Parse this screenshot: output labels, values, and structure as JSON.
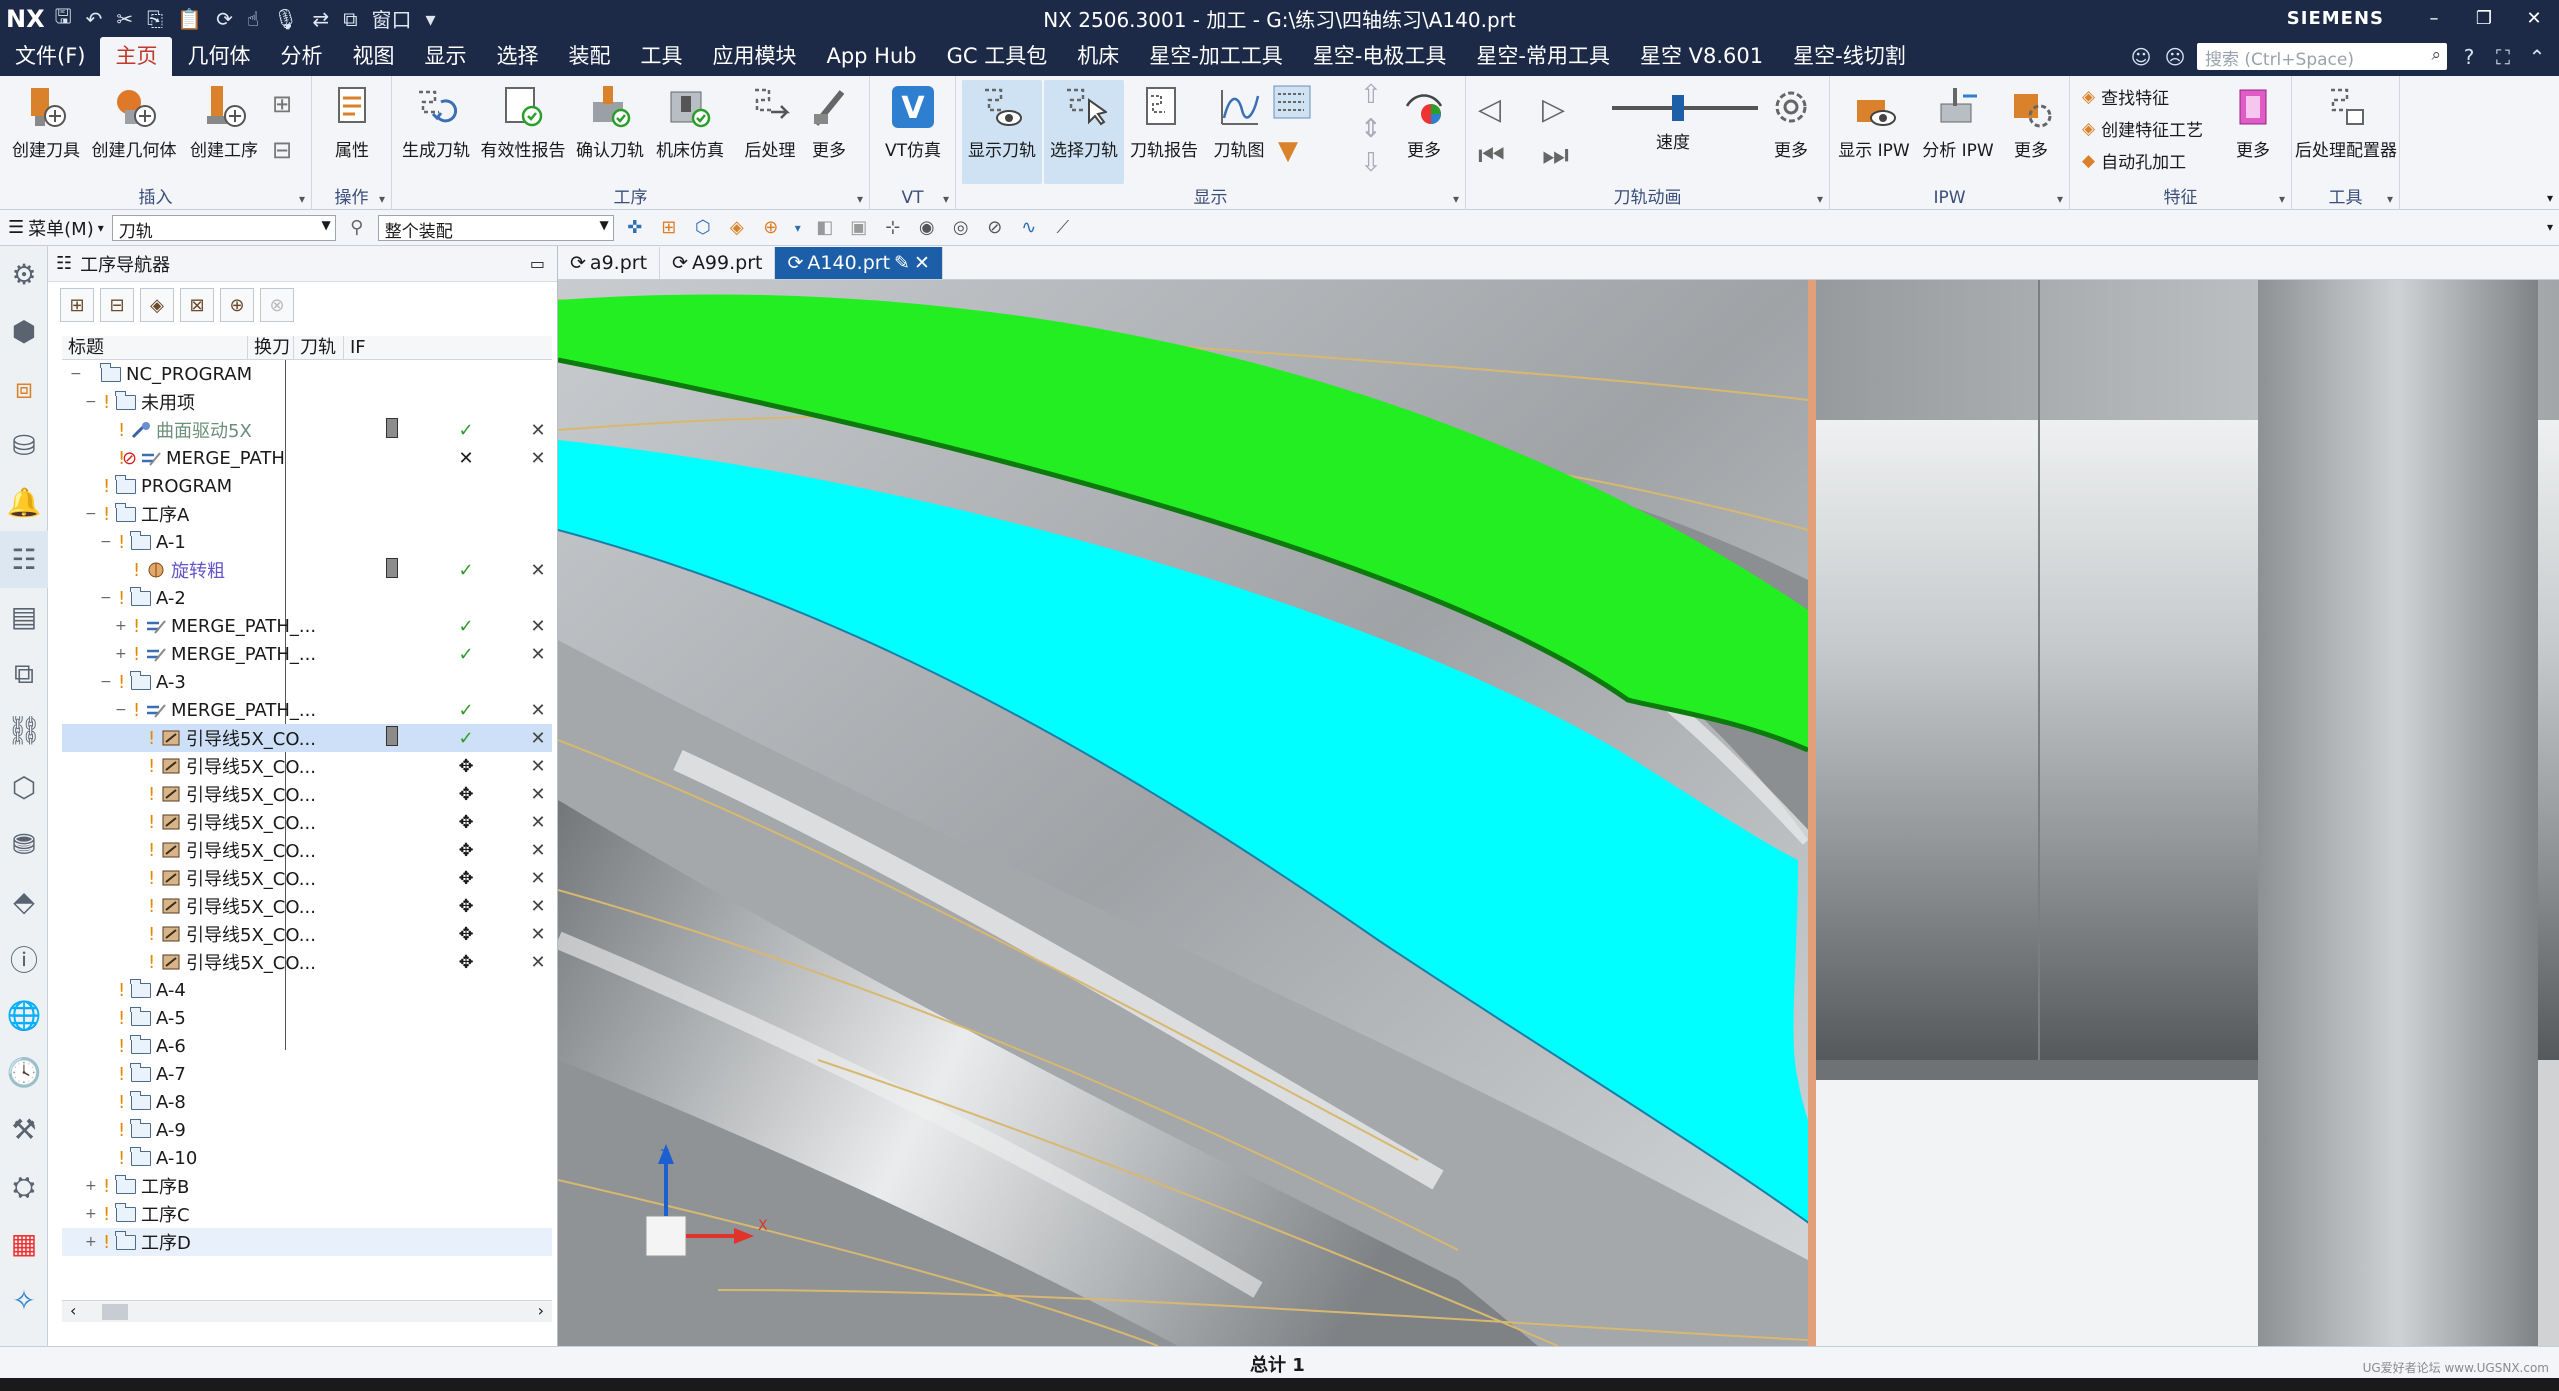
{
  "app": {
    "logo": "NX",
    "window_title": "NX 2506.3001 - 加工 - G:\\练习\\四轴练习\\A140.prt",
    "brand": "SIEMENS",
    "quick_window_label": "窗口"
  },
  "menu": {
    "tabs": [
      "文件(F)",
      "主页",
      "几何体",
      "分析",
      "视图",
      "显示",
      "选择",
      "装配",
      "工具",
      "应用模块",
      "App Hub",
      "GC 工具包",
      "机床",
      "星空-加工工具",
      "星空-电极工具",
      "星空-常用工具",
      "星空 V8.601",
      "星空-线切割"
    ],
    "active_index": 1,
    "search_placeholder": "搜索 (Ctrl+Space)"
  },
  "ribbon": {
    "insert": {
      "label": "插入",
      "buttons": [
        "创建刀具",
        "创建几何体",
        "创建工序"
      ]
    },
    "ops": {
      "label": "操作",
      "buttons": [
        "属性"
      ]
    },
    "process": {
      "label": "工序",
      "buttons": [
        "生成刀轨",
        "有效性报告",
        "确认刀轨",
        "机床仿真",
        "后处理",
        "更多"
      ]
    },
    "vt": {
      "label": "VT",
      "buttons": [
        "VT仿真"
      ]
    },
    "display": {
      "label": "显示",
      "buttons": [
        "显示刀轨",
        "选择刀轨",
        "刀轨报告",
        "刀轨图",
        "更多"
      ]
    },
    "anim": {
      "label": "刀轨动画",
      "speed_label": "速度",
      "more": "更多"
    },
    "ipw": {
      "label": "IPW",
      "buttons": [
        "显示 IPW",
        "分析 IPW",
        "更多"
      ]
    },
    "feature": {
      "label": "特征",
      "items": [
        "查找特征",
        "创建特征工艺",
        "自动孔加工"
      ],
      "more": "更多"
    },
    "tools": {
      "label": "工具",
      "buttons": [
        "后处理配置器"
      ]
    }
  },
  "toolbar2": {
    "menu_label": "菜单(M)",
    "filter_value": "刀轨",
    "assembly_value": "整个装配"
  },
  "navigator": {
    "title": "工序导航器",
    "columns": [
      "标题",
      "换刀",
      "刀轨",
      "IF"
    ],
    "rows": [
      {
        "label": "NC_PROGRAM",
        "indent": 0,
        "exp": "−",
        "icon": "folder",
        "style": "",
        "tool": "",
        "path": "",
        "if": ""
      },
      {
        "label": "未用项",
        "indent": 1,
        "exp": "−",
        "icon": "folder",
        "style": "",
        "tool": "",
        "path": "",
        "if": ""
      },
      {
        "label": "曲面驱动5X",
        "indent": 2,
        "exp": "",
        "icon": "op",
        "style": "gray",
        "tool": "■",
        "path": "✓",
        "if": "✕"
      },
      {
        "label": "MERGE_PATH",
        "indent": 2,
        "exp": "",
        "icon": "merge",
        "style": "",
        "tool": "",
        "path": "✕",
        "if": "✕",
        "status": "⊘"
      },
      {
        "label": "PROGRAM",
        "indent": 1,
        "exp": "",
        "icon": "folder",
        "style": "",
        "tool": "",
        "path": "",
        "if": ""
      },
      {
        "label": "工序A",
        "indent": 1,
        "exp": "−",
        "icon": "folder",
        "style": "",
        "tool": "",
        "path": "",
        "if": ""
      },
      {
        "label": "A-1",
        "indent": 2,
        "exp": "−",
        "icon": "folder",
        "style": "",
        "tool": "",
        "path": "",
        "if": ""
      },
      {
        "label": "旋转粗",
        "indent": 3,
        "exp": "",
        "icon": "rot",
        "style": "blue",
        "tool": "■",
        "path": "✓",
        "if": "✕"
      },
      {
        "label": "A-2",
        "indent": 2,
        "exp": "−",
        "icon": "folder",
        "style": "",
        "tool": "",
        "path": "",
        "if": ""
      },
      {
        "label": "MERGE_PATH_...",
        "indent": 3,
        "exp": "+",
        "icon": "merge",
        "style": "",
        "tool": "",
        "path": "✓",
        "if": "✕"
      },
      {
        "label": "MERGE_PATH_...",
        "indent": 3,
        "exp": "+",
        "icon": "merge",
        "style": "",
        "tool": "",
        "path": "✓",
        "if": "✕"
      },
      {
        "label": "A-3",
        "indent": 2,
        "exp": "−",
        "icon": "folder",
        "style": "",
        "tool": "",
        "path": "",
        "if": ""
      },
      {
        "label": "MERGE_PATH_...",
        "indent": 3,
        "exp": "−",
        "icon": "merge",
        "style": "",
        "tool": "",
        "path": "✓",
        "if": "✕"
      },
      {
        "label": "引导线5X_CO...",
        "indent": 4,
        "exp": "",
        "icon": "guide",
        "style": "",
        "tool": "■",
        "path": "✓",
        "if": "✕",
        "selected": true
      },
      {
        "label": "引导线5X_CO...",
        "indent": 4,
        "exp": "",
        "icon": "guide",
        "style": "",
        "tool": "",
        "path": "✥",
        "if": "✕"
      },
      {
        "label": "引导线5X_CO...",
        "indent": 4,
        "exp": "",
        "icon": "guide",
        "style": "",
        "tool": "",
        "path": "✥",
        "if": "✕"
      },
      {
        "label": "引导线5X_CO...",
        "indent": 4,
        "exp": "",
        "icon": "guide",
        "style": "",
        "tool": "",
        "path": "✥",
        "if": "✕"
      },
      {
        "label": "引导线5X_CO...",
        "indent": 4,
        "exp": "",
        "icon": "guide",
        "style": "",
        "tool": "",
        "path": "✥",
        "if": "✕"
      },
      {
        "label": "引导线5X_CO...",
        "indent": 4,
        "exp": "",
        "icon": "guide",
        "style": "",
        "tool": "",
        "path": "✥",
        "if": "✕"
      },
      {
        "label": "引导线5X_CO...",
        "indent": 4,
        "exp": "",
        "icon": "guide",
        "style": "",
        "tool": "",
        "path": "✥",
        "if": "✕"
      },
      {
        "label": "引导线5X_CO...",
        "indent": 4,
        "exp": "",
        "icon": "guide",
        "style": "",
        "tool": "",
        "path": "✥",
        "if": "✕"
      },
      {
        "label": "引导线5X_CO...",
        "indent": 4,
        "exp": "",
        "icon": "guide",
        "style": "",
        "tool": "",
        "path": "✥",
        "if": "✕"
      },
      {
        "label": "A-4",
        "indent": 2,
        "exp": "",
        "icon": "folder",
        "style": "",
        "tool": "",
        "path": "",
        "if": ""
      },
      {
        "label": "A-5",
        "indent": 2,
        "exp": "",
        "icon": "folder",
        "style": "",
        "tool": "",
        "path": "",
        "if": ""
      },
      {
        "label": "A-6",
        "indent": 2,
        "exp": "",
        "icon": "folder",
        "style": "",
        "tool": "",
        "path": "",
        "if": ""
      },
      {
        "label": "A-7",
        "indent": 2,
        "exp": "",
        "icon": "folder",
        "style": "",
        "tool": "",
        "path": "",
        "if": ""
      },
      {
        "label": "A-8",
        "indent": 2,
        "exp": "",
        "icon": "folder",
        "style": "",
        "tool": "",
        "path": "",
        "if": ""
      },
      {
        "label": "A-9",
        "indent": 2,
        "exp": "",
        "icon": "folder",
        "style": "",
        "tool": "",
        "path": "",
        "if": ""
      },
      {
        "label": "A-10",
        "indent": 2,
        "exp": "",
        "icon": "folder",
        "style": "",
        "tool": "",
        "path": "",
        "if": ""
      },
      {
        "label": "工序B",
        "indent": 1,
        "exp": "+",
        "icon": "folder",
        "style": "",
        "tool": "",
        "path": "",
        "if": ""
      },
      {
        "label": "工序C",
        "indent": 1,
        "exp": "+",
        "icon": "folder",
        "style": "",
        "tool": "",
        "path": "",
        "if": ""
      },
      {
        "label": "工序D",
        "indent": 1,
        "exp": "+",
        "icon": "folder",
        "style": "",
        "tool": "",
        "path": "",
        "if": "",
        "hover": true
      }
    ]
  },
  "doc_tabs": [
    "a9.prt",
    "A99.prt",
    "A140.prt"
  ],
  "active_doc_index": 2,
  "viewport": {
    "axis_z": "Z",
    "axis_x": "X",
    "colors": {
      "green": "#22ee22",
      "cyan": "#00ffff",
      "part": "#a9adb0"
    }
  },
  "status": {
    "text": "总计 1",
    "watermark": "UG爱好者论坛 www.UGSNX.com"
  }
}
